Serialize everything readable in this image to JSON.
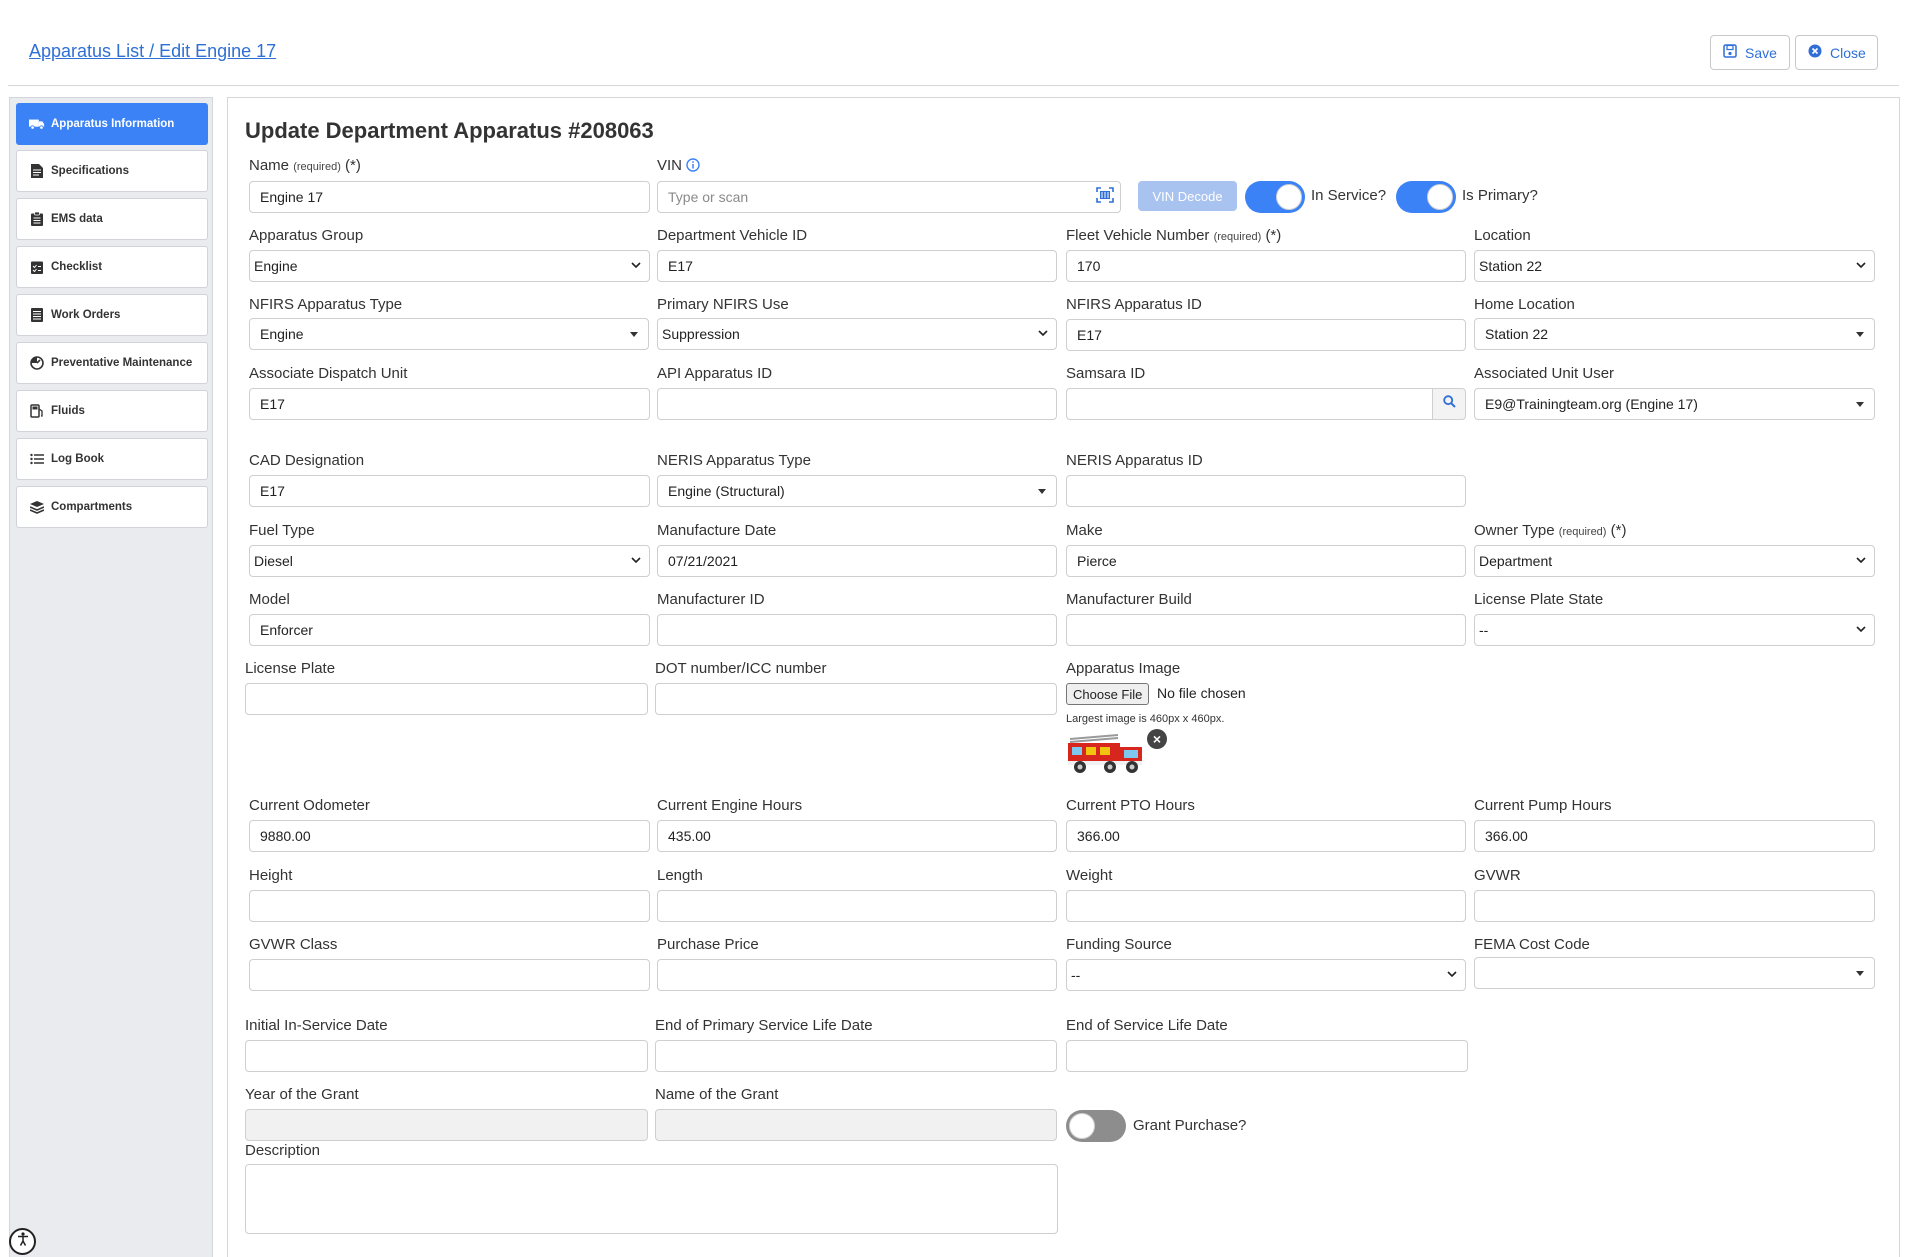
{
  "header": {
    "breadcrumb": "Apparatus List / Edit Engine 17",
    "save_label": "Save",
    "close_label": "Close"
  },
  "sidebar": {
    "items": [
      {
        "label": "Apparatus Information",
        "icon": "truck-icon"
      },
      {
        "label": "Specifications",
        "icon": "document-icon"
      },
      {
        "label": "EMS data",
        "icon": "clipboard-icon"
      },
      {
        "label": "Checklist",
        "icon": "checklist-icon"
      },
      {
        "label": "Work Orders",
        "icon": "list-doc-icon"
      },
      {
        "label": "Preventative Maintenance",
        "icon": "gauge-icon"
      },
      {
        "label": "Fluids",
        "icon": "fuel-icon"
      },
      {
        "label": "Log Book",
        "icon": "list-icon"
      },
      {
        "label": "Compartments",
        "icon": "layers-icon"
      }
    ]
  },
  "form": {
    "title": "Update Department Apparatus #208063",
    "name": {
      "label": "Name",
      "req": "(required)",
      "star": "(*)",
      "value": "Engine 17"
    },
    "vin": {
      "label": "VIN",
      "placeholder": "Type or scan"
    },
    "vin_decode": "VIN Decode",
    "in_service": "In Service?",
    "is_primary": "Is Primary?",
    "apparatus_group": {
      "label": "Apparatus Group",
      "value": "Engine"
    },
    "department_vehicle_id": {
      "label": "Department Vehicle ID",
      "value": "E17"
    },
    "fleet_vehicle_number": {
      "label": "Fleet Vehicle Number",
      "req": "(required)",
      "star": "(*)",
      "value": "170"
    },
    "location": {
      "label": "Location",
      "value": "Station 22"
    },
    "nfirs_apparatus_type": {
      "label": "NFIRS Apparatus Type",
      "value": "Engine"
    },
    "primary_nfirs_use": {
      "label": "Primary NFIRS Use",
      "value": "Suppression"
    },
    "nfirs_apparatus_id": {
      "label": "NFIRS Apparatus ID",
      "value": "E17"
    },
    "home_location": {
      "label": "Home Location",
      "value": "Station 22"
    },
    "associate_dispatch_unit": {
      "label": "Associate Dispatch Unit",
      "value": "E17"
    },
    "api_apparatus_id": {
      "label": "API Apparatus ID",
      "value": ""
    },
    "samsara_id": {
      "label": "Samsara ID",
      "value": ""
    },
    "associated_unit_user": {
      "label": "Associated Unit User",
      "value": "E9@Trainingteam.org (Engine 17)"
    },
    "cad_designation": {
      "label": "CAD Designation",
      "value": "E17"
    },
    "neris_apparatus_type": {
      "label": "NERIS Apparatus Type",
      "value": "Engine (Structural)"
    },
    "neris_apparatus_id": {
      "label": "NERIS Apparatus ID",
      "value": ""
    },
    "fuel_type": {
      "label": "Fuel Type",
      "value": "Diesel"
    },
    "manufacture_date": {
      "label": "Manufacture Date",
      "value": "07/21/2021"
    },
    "make": {
      "label": "Make",
      "value": "Pierce"
    },
    "owner_type": {
      "label": "Owner Type",
      "req": "(required)",
      "star": "(*)",
      "value": "Department"
    },
    "model": {
      "label": "Model",
      "value": "Enforcer"
    },
    "manufacturer_id": {
      "label": "Manufacturer ID",
      "value": ""
    },
    "manufacturer_build": {
      "label": "Manufacturer Build",
      "value": ""
    },
    "license_plate_state": {
      "label": "License Plate State",
      "value": "--"
    },
    "license_plate": {
      "label": "License Plate",
      "value": ""
    },
    "dot_number": {
      "label": "DOT number/ICC number",
      "value": ""
    },
    "apparatus_image": {
      "label": "Apparatus Image",
      "button": "Choose File",
      "status": "No file chosen",
      "hint": "Largest image is 460px x 460px."
    },
    "current_odometer": {
      "label": "Current Odometer",
      "value": "9880.00"
    },
    "current_engine_hours": {
      "label": "Current Engine Hours",
      "value": "435.00"
    },
    "current_pto_hours": {
      "label": "Current PTO Hours",
      "value": "366.00"
    },
    "current_pump_hours": {
      "label": "Current Pump Hours",
      "value": "366.00"
    },
    "height": {
      "label": "Height",
      "value": ""
    },
    "length": {
      "label": "Length",
      "value": ""
    },
    "weight": {
      "label": "Weight",
      "value": ""
    },
    "gvwr": {
      "label": "GVWR",
      "value": ""
    },
    "gvwr_class": {
      "label": "GVWR Class",
      "value": ""
    },
    "purchase_price": {
      "label": "Purchase Price",
      "value": ""
    },
    "funding_source": {
      "label": "Funding Source",
      "value": "--"
    },
    "fema_cost_code": {
      "label": "FEMA Cost Code",
      "value": ""
    },
    "initial_in_service_date": {
      "label": "Initial In-Service Date",
      "value": ""
    },
    "end_primary_service_life": {
      "label": "End of Primary Service Life Date",
      "value": ""
    },
    "end_service_life": {
      "label": "End of Service Life Date",
      "value": ""
    },
    "year_of_grant": {
      "label": "Year of the Grant",
      "value": ""
    },
    "name_of_grant": {
      "label": "Name of the Grant",
      "value": ""
    },
    "grant_purchase": "Grant Purchase?",
    "description": {
      "label": "Description",
      "value": ""
    }
  },
  "colors": {
    "accent": "#3b82f6",
    "link": "#2f6fd6"
  }
}
